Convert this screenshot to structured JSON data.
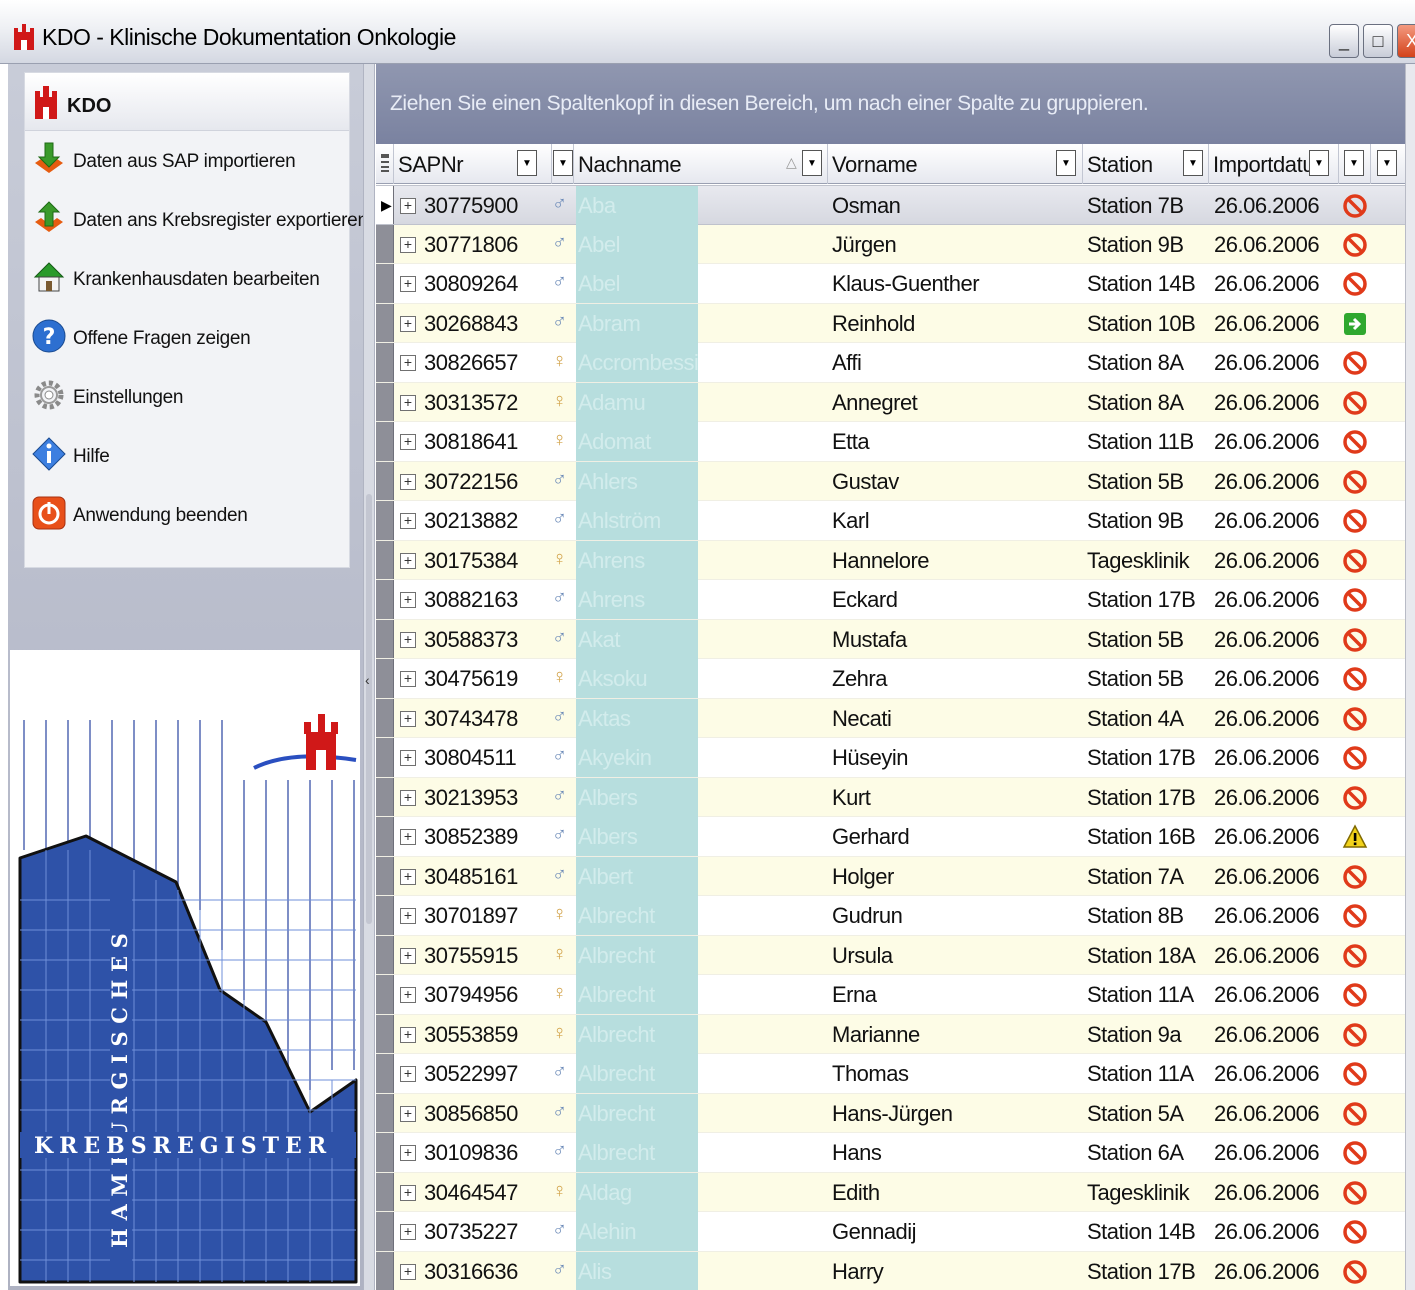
{
  "window": {
    "title": "KDO - Klinische Dokumentation Onkologie",
    "buttons": {
      "min": "_",
      "max": "□",
      "close": "X"
    }
  },
  "nav": {
    "title": "KDO",
    "items": [
      {
        "label": "Daten aus SAP importieren",
        "icon": "import-arrow-icon"
      },
      {
        "label": "Daten ans Krebsregister exportieren",
        "icon": "export-arrow-icon"
      },
      {
        "label": "Krankenhausdaten bearbeiten",
        "icon": "hospital-edit-icon"
      },
      {
        "label": "Offene Fragen zeigen",
        "icon": "question-icon"
      },
      {
        "label": "Einstellungen",
        "icon": "gear-icon"
      },
      {
        "label": "Hilfe",
        "icon": "info-icon"
      },
      {
        "label": "Anwendung beenden",
        "icon": "power-icon"
      }
    ]
  },
  "banner": {
    "vertical_text": "HAMBURGISCHES",
    "horizontal_text": "KREBSREGISTER"
  },
  "grid": {
    "group_hint": "Ziehen Sie einen Spaltenkopf in diesen Bereich, um nach einer Spalte zu gruppieren.",
    "columns": [
      "SAPNr",
      "Nachname",
      "Vorname",
      "Station",
      "Importdatu"
    ],
    "dropdown_glyph": "▼",
    "sort_glyph": "△",
    "row_arrow": "▶",
    "expand_glyph": "+",
    "rows": [
      {
        "sap": "30775900",
        "sex": "♂",
        "name": "Aba",
        "vor": "Osman",
        "sta": "Station 7B",
        "dat": "26.06.2006",
        "status": "blocked"
      },
      {
        "sap": "30771806",
        "sex": "♂",
        "name": "Abel",
        "vor": "Jürgen",
        "sta": "Station 9B",
        "dat": "26.06.2006",
        "status": "blocked"
      },
      {
        "sap": "30809264",
        "sex": "♂",
        "name": "Abel",
        "vor": "Klaus-Guenther",
        "sta": "Station 14B",
        "dat": "26.06.2006",
        "status": "blocked"
      },
      {
        "sap": "30268843",
        "sex": "♂",
        "name": "Abram",
        "vor": "Reinhold",
        "sta": "Station 10B",
        "dat": "26.06.2006",
        "status": "exported"
      },
      {
        "sap": "30826657",
        "sex": "♀",
        "name": "Accrombessi",
        "vor": "Affi",
        "sta": "Station 8A",
        "dat": "26.06.2006",
        "status": "blocked"
      },
      {
        "sap": "30313572",
        "sex": "♀",
        "name": "Adamu",
        "vor": "Annegret",
        "sta": "Station 8A",
        "dat": "26.06.2006",
        "status": "blocked"
      },
      {
        "sap": "30818641",
        "sex": "♀",
        "name": "Adomat",
        "vor": "Etta",
        "sta": "Station 11B",
        "dat": "26.06.2006",
        "status": "blocked"
      },
      {
        "sap": "30722156",
        "sex": "♂",
        "name": "Ahlers",
        "vor": "Gustav",
        "sta": "Station 5B",
        "dat": "26.06.2006",
        "status": "blocked"
      },
      {
        "sap": "30213882",
        "sex": "♂",
        "name": "Ahlström",
        "vor": "Karl",
        "sta": "Station 9B",
        "dat": "26.06.2006",
        "status": "blocked"
      },
      {
        "sap": "30175384",
        "sex": "♀",
        "name": "Ahrens",
        "vor": "Hannelore",
        "sta": "Tagesklinik",
        "dat": "26.06.2006",
        "status": "blocked"
      },
      {
        "sap": "30882163",
        "sex": "♂",
        "name": "Ahrens",
        "vor": "Eckard",
        "sta": "Station 17B",
        "dat": "26.06.2006",
        "status": "blocked"
      },
      {
        "sap": "30588373",
        "sex": "♂",
        "name": "Akat",
        "vor": "Mustafa",
        "sta": "Station 5B",
        "dat": "26.06.2006",
        "status": "blocked"
      },
      {
        "sap": "30475619",
        "sex": "♀",
        "name": "Aksoku",
        "vor": "Zehra",
        "sta": "Station 5B",
        "dat": "26.06.2006",
        "status": "blocked"
      },
      {
        "sap": "30743478",
        "sex": "♂",
        "name": "Aktas",
        "vor": "Necati",
        "sta": "Station 4A",
        "dat": "26.06.2006",
        "status": "blocked"
      },
      {
        "sap": "30804511",
        "sex": "♂",
        "name": "Akyekin",
        "vor": "Hüseyin",
        "sta": "Station 17B",
        "dat": "26.06.2006",
        "status": "blocked"
      },
      {
        "sap": "30213953",
        "sex": "♂",
        "name": "Albers",
        "vor": "Kurt",
        "sta": "Station 17B",
        "dat": "26.06.2006",
        "status": "blocked"
      },
      {
        "sap": "30852389",
        "sex": "♂",
        "name": "Albers",
        "vor": "Gerhard",
        "sta": "Station 16B",
        "dat": "26.06.2006",
        "status": "warning"
      },
      {
        "sap": "30485161",
        "sex": "♂",
        "name": "Albert",
        "vor": "Holger",
        "sta": "Station 7A",
        "dat": "26.06.2006",
        "status": "blocked"
      },
      {
        "sap": "30701897",
        "sex": "♀",
        "name": "Albrecht",
        "vor": "Gudrun",
        "sta": "Station 8B",
        "dat": "26.06.2006",
        "status": "blocked"
      },
      {
        "sap": "30755915",
        "sex": "♀",
        "name": "Albrecht",
        "vor": "Ursula",
        "sta": "Station 18A",
        "dat": "26.06.2006",
        "status": "blocked"
      },
      {
        "sap": "30794956",
        "sex": "♀",
        "name": "Albrecht",
        "vor": "Erna",
        "sta": "Station 11A",
        "dat": "26.06.2006",
        "status": "blocked"
      },
      {
        "sap": "30553859",
        "sex": "♀",
        "name": "Albrecht",
        "vor": "Marianne",
        "sta": "Station 9a",
        "dat": "26.06.2006",
        "status": "blocked"
      },
      {
        "sap": "30522997",
        "sex": "♂",
        "name": "Albrecht",
        "vor": "Thomas",
        "sta": "Station 11A",
        "dat": "26.06.2006",
        "status": "blocked"
      },
      {
        "sap": "30856850",
        "sex": "♂",
        "name": "Albrecht",
        "vor": "Hans-Jürgen",
        "sta": "Station 5A",
        "dat": "26.06.2006",
        "status": "blocked"
      },
      {
        "sap": "30109836",
        "sex": "♂",
        "name": "Albrecht",
        "vor": "Hans",
        "sta": "Station 6A",
        "dat": "26.06.2006",
        "status": "blocked"
      },
      {
        "sap": "30464547",
        "sex": "♀",
        "name": "Aldag",
        "vor": "Edith",
        "sta": "Tagesklinik",
        "dat": "26.06.2006",
        "status": "blocked"
      },
      {
        "sap": "30735227",
        "sex": "♂",
        "name": "Alehin",
        "vor": "Gennadij",
        "sta": "Station 14B",
        "dat": "26.06.2006",
        "status": "blocked"
      },
      {
        "sap": "30316636",
        "sex": "♂",
        "name": "Alis",
        "vor": "Harry",
        "sta": "Station 17B",
        "dat": "26.06.2006",
        "status": "blocked"
      }
    ]
  }
}
